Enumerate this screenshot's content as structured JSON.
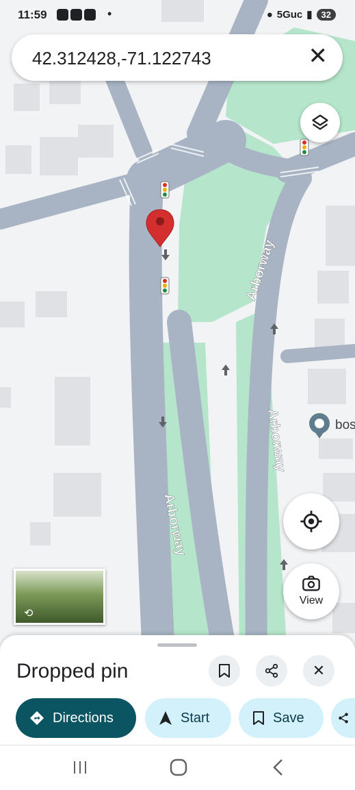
{
  "status_bar": {
    "time": "11:59",
    "dot": "•",
    "network": "5Guc",
    "battery": "32"
  },
  "search": {
    "query": "42.312428,-71.122743",
    "clear_icon": "close-icon"
  },
  "map": {
    "road_labels": [
      "Arborway",
      "Arborway",
      "Arborway"
    ],
    "place_label": "bos"
  },
  "controls": {
    "view_label": "View"
  },
  "place_sheet": {
    "title": "Dropped pin",
    "actions": [
      {
        "label": "Directions",
        "icon": "directions-diamond-icon",
        "bg": "#0b5563",
        "fg": "#ffffff"
      },
      {
        "label": "Start",
        "icon": "navigation-arrow-icon",
        "bg": "#d3f1fb",
        "fg": "#0b3a4a"
      },
      {
        "label": "Save",
        "icon": "bookmark-icon",
        "bg": "#d3f1fb",
        "fg": "#0b3a4a"
      }
    ]
  },
  "colors": {
    "road": "#a8b4c4",
    "park": "#b5e6cb",
    "land": "#f1f3f4",
    "building": "#dfe1e5",
    "pin": "#d32f2f"
  }
}
